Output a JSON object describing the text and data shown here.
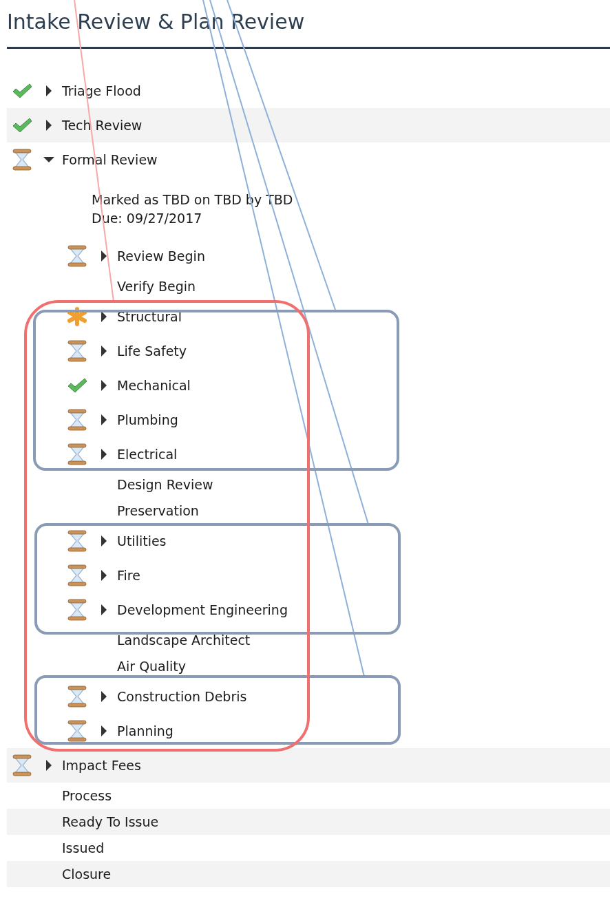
{
  "title": "Intake Review & Plan Review",
  "tasks": [
    {
      "label": "Triage Flood",
      "kind": "done",
      "expanded": false
    },
    {
      "label": "Tech Review",
      "kind": "done",
      "expanded": false
    },
    {
      "label": "Formal Review",
      "kind": "pending",
      "expanded": true,
      "note": [
        "Marked as TBD on TBD by TBD",
        "Due:  09/27/2017"
      ],
      "children": [
        {
          "label": "Review Begin",
          "kind": "pending",
          "expanded": false
        },
        {
          "label": "Verify Begin",
          "kind": "plain"
        },
        {
          "label": "Structural",
          "kind": "flagged",
          "expanded": false
        },
        {
          "label": "Life Safety",
          "kind": "pending",
          "expanded": false
        },
        {
          "label": "Mechanical",
          "kind": "done",
          "expanded": false
        },
        {
          "label": "Plumbing",
          "kind": "pending",
          "expanded": false
        },
        {
          "label": "Electrical",
          "kind": "pending",
          "expanded": false
        },
        {
          "label": "Design Review",
          "kind": "plain"
        },
        {
          "label": "Preservation",
          "kind": "plain"
        },
        {
          "label": "Utilities",
          "kind": "pending",
          "expanded": false
        },
        {
          "label": "Fire",
          "kind": "pending",
          "expanded": false
        },
        {
          "label": "Development Engineering",
          "kind": "pending",
          "expanded": false
        },
        {
          "label": "Landscape Architect",
          "kind": "plain"
        },
        {
          "label": "Air Quality",
          "kind": "plain"
        },
        {
          "label": "Construction Debris",
          "kind": "pending",
          "expanded": false
        },
        {
          "label": "Planning",
          "kind": "pending",
          "expanded": false
        }
      ]
    },
    {
      "label": "Impact Fees",
      "kind": "pending",
      "expanded": false
    },
    {
      "label": "Process",
      "kind": "plain"
    },
    {
      "label": "Ready To Issue",
      "kind": "plain"
    },
    {
      "label": "Issued",
      "kind": "plain"
    },
    {
      "label": "Closure",
      "kind": "plain"
    }
  ]
}
